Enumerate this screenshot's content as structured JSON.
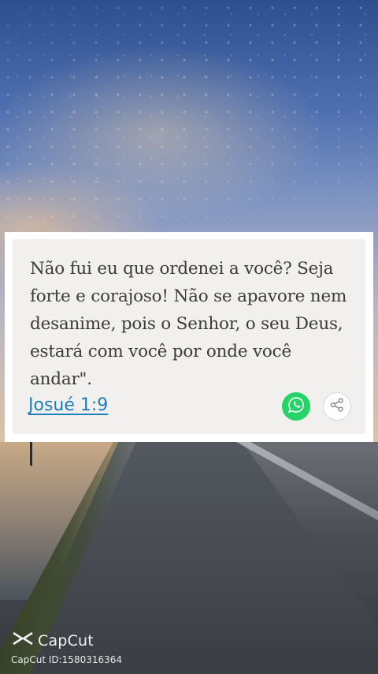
{
  "card": {
    "verse_text": "Não fui eu que ordenei a você? Seja forte e corajoso! Não se apavore nem desanime, pois o Senhor, o seu Deus, estará com você por onde você andar\".",
    "reference": "Josué 1:9"
  },
  "actions": {
    "whatsapp_icon": "whatsapp-icon",
    "share_icon": "share-icon",
    "whatsapp_color": "#25d366"
  },
  "watermark": {
    "brand": "CapCut",
    "id_text": "CapCut ID:1580316364"
  },
  "colors": {
    "link": "#1e7fb3",
    "card_bg": "#f1f0ee",
    "text": "#3b3b3b"
  }
}
